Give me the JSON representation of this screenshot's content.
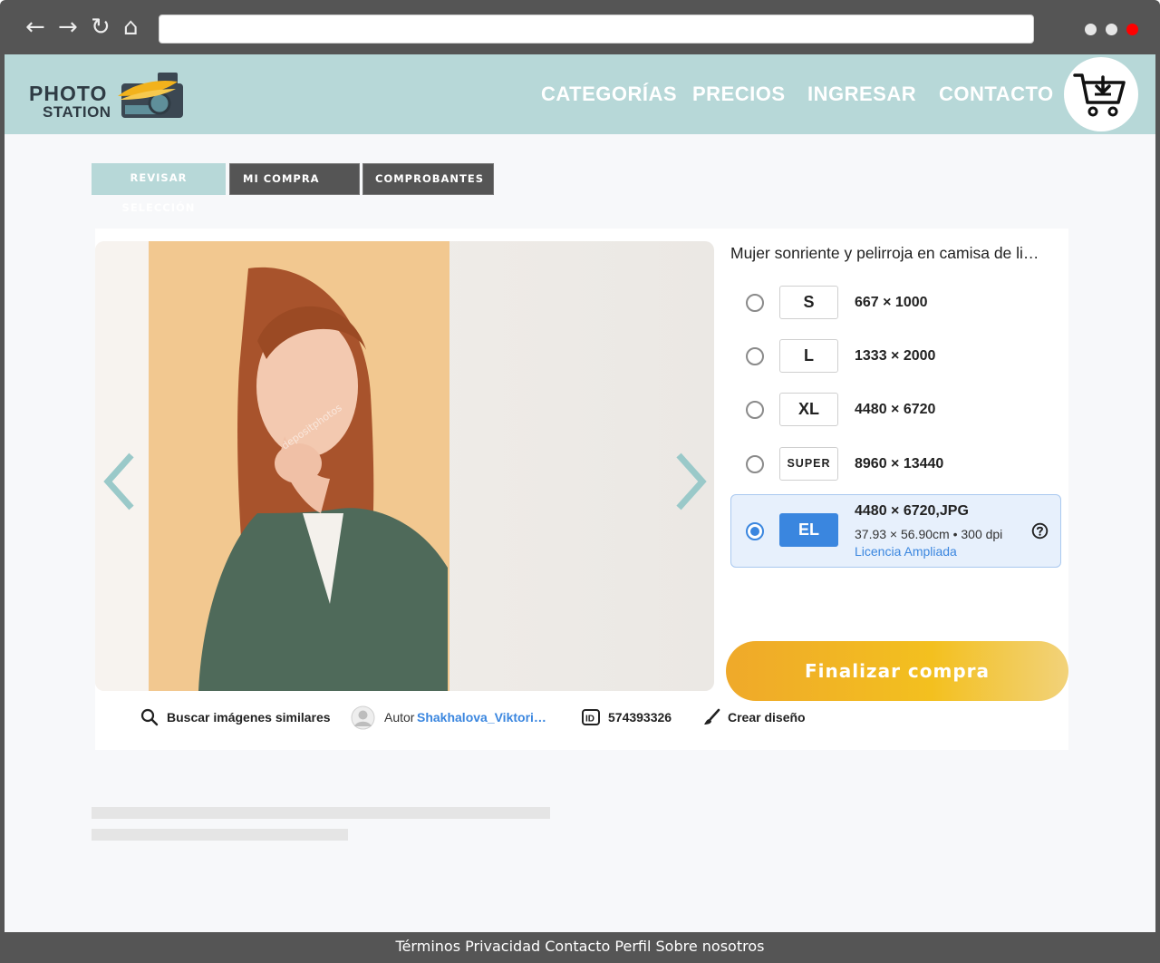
{
  "browser": {
    "back_glyph": "←",
    "forward_glyph": "→",
    "reload_glyph": "↻",
    "home_glyph": "⌂",
    "address_value": "",
    "dots_colors": [
      "#e6e6e6",
      "#e6e6e6",
      "#ff0000"
    ]
  },
  "brand": {
    "logo_line1": "PHOTO",
    "logo_line2": "STATION",
    "header_bg": "#b7d8d8"
  },
  "nav": {
    "items": [
      "CATEGORÍAS",
      "PRECIOS",
      "INGRESAR",
      "CONTACTO"
    ],
    "cart_icon": "cart-download-icon"
  },
  "tabs": [
    "REVISAR SELECCIÓN",
    "MI COMPRA",
    "COMPROBANTES"
  ],
  "product": {
    "title": "Mujer sonriente y pelirroja en camisa de li…",
    "watermark": "depositphotos",
    "options": [
      {
        "size": "S",
        "dimensions": "667 × 1000",
        "selected": false
      },
      {
        "size": "L",
        "dimensions": "1333 × 2000",
        "selected": false
      },
      {
        "size": "XL",
        "dimensions": "4480 × 6720",
        "selected": false
      },
      {
        "size": "SUPER",
        "dimensions": "8960 × 13440",
        "selected": false
      }
    ],
    "selected_option": {
      "size": "EL",
      "dimensions": "4480 × 6720,JPG",
      "details": "37.93 × 56.90cm • 300 dpi",
      "license": "Licencia Ampliada",
      "selected": true
    },
    "checkout_label": "Finalizar compra"
  },
  "meta": {
    "search_similar": "Buscar imágenes similares",
    "author_label": "Autor",
    "author_name": "Shakhalova_Viktori…",
    "id_value": "574393326",
    "create_design": "Crear diseño"
  },
  "footer": {
    "links": [
      "Términos",
      "Privacidad",
      "Contacto",
      "Perfil",
      "Sobre nosotros"
    ]
  }
}
